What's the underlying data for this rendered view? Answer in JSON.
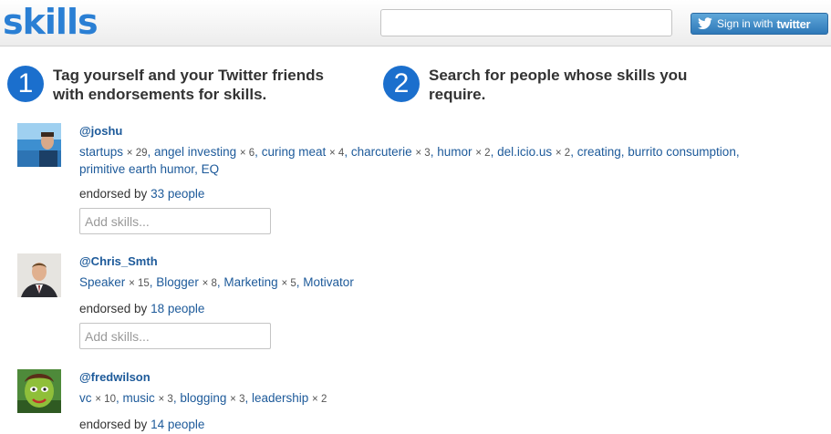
{
  "header": {
    "logo": "skills",
    "search_value": "",
    "signin_label": "Sign in with",
    "signin_brand": "twitter"
  },
  "steps": [
    {
      "number": "1",
      "text": "Tag yourself and your Twitter friends with endorsements for skills."
    },
    {
      "number": "2",
      "text": "Search for people whose skills you require."
    }
  ],
  "people": [
    {
      "handle": "@joshu",
      "skills": [
        {
          "name": "startups",
          "count": "× 29"
        },
        {
          "name": "angel investing",
          "count": "× 6"
        },
        {
          "name": "curing meat",
          "count": "× 4"
        },
        {
          "name": "charcuterie",
          "count": "× 3"
        },
        {
          "name": "humor",
          "count": "× 2"
        },
        {
          "name": "del.icio.us",
          "count": "× 2"
        },
        {
          "name": "creating",
          "count": ""
        },
        {
          "name": "burrito consumption",
          "count": ""
        },
        {
          "name": "primitive earth humor",
          "count": ""
        },
        {
          "name": "EQ",
          "count": ""
        }
      ],
      "endorsed_prefix": "endorsed by",
      "endorsed_link": "33 people",
      "add_placeholder": "Add skills..."
    },
    {
      "handle": "@Chris_Smth",
      "skills": [
        {
          "name": "Speaker",
          "count": "× 15"
        },
        {
          "name": "Blogger",
          "count": "× 8"
        },
        {
          "name": "Marketing",
          "count": "× 5"
        },
        {
          "name": "Motivator",
          "count": ""
        }
      ],
      "endorsed_prefix": "endorsed by",
      "endorsed_link": "18 people",
      "add_placeholder": "Add skills..."
    },
    {
      "handle": "@fredwilson",
      "skills": [
        {
          "name": "vc",
          "count": "× 10"
        },
        {
          "name": "music",
          "count": "× 3"
        },
        {
          "name": "blogging",
          "count": "× 3"
        },
        {
          "name": "leadership",
          "count": "× 2"
        }
      ],
      "endorsed_prefix": "endorsed by",
      "endorsed_link": "14 people",
      "add_placeholder": ""
    }
  ],
  "colors": {
    "accent": "#1b6fcd",
    "link": "#1d5a9a",
    "logo": "#2a7fd4"
  },
  "icons": {
    "signin": "twitter-bird-icon"
  }
}
